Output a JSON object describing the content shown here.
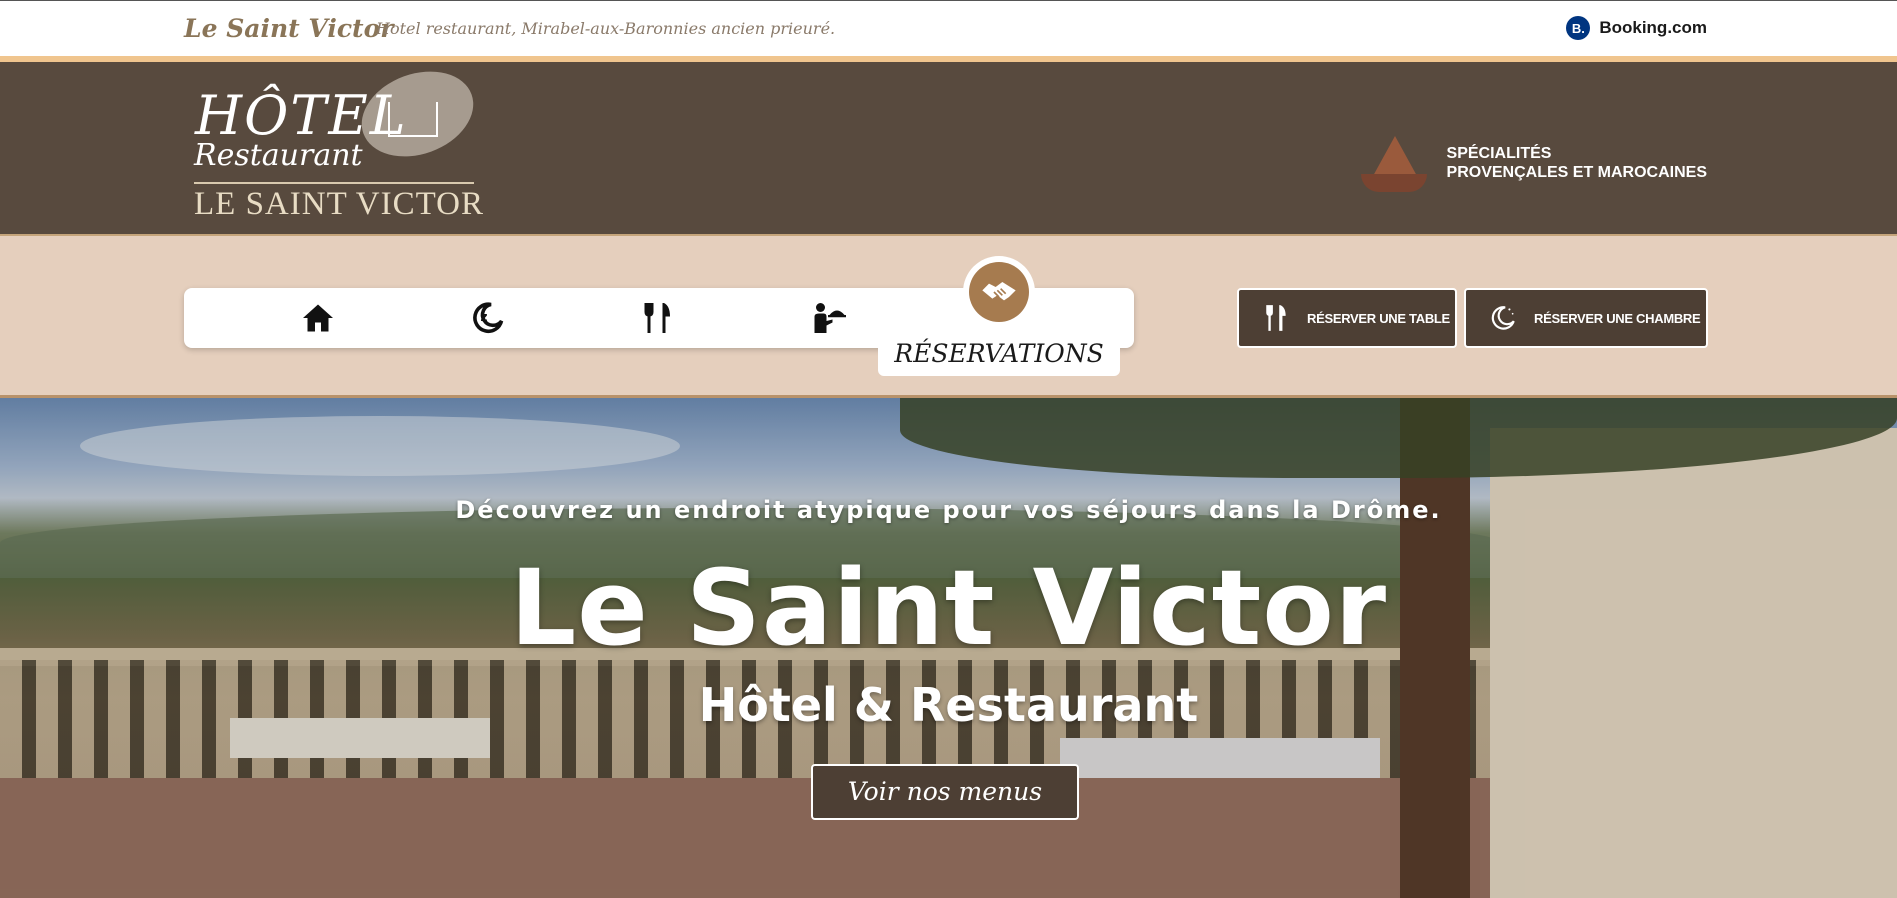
{
  "topbar": {
    "brand": "Le Saint Victor",
    "tagline": "Hotel restaurant, Mirabel-aux-Baronnies ancien prieuré.",
    "booking_icon": "B.",
    "booking_label": "Booking.com"
  },
  "header": {
    "logo": {
      "line1": "HÔTEL",
      "line2": "Restaurant",
      "line3": "LE SAINT VICTOR"
    },
    "specialites": {
      "line1": "SPÉCIALITÉS",
      "line2": "PROVENÇALES ET MAROCAINES",
      "icon": "tajine-icon"
    }
  },
  "nav": {
    "items": [
      {
        "icon": "home-icon"
      },
      {
        "icon": "moon-icon"
      },
      {
        "icon": "cutlery-icon"
      },
      {
        "icon": "waiter-icon"
      },
      {
        "icon": "handshake-icon",
        "label": "RÉSERVATIONS",
        "active": true
      }
    ]
  },
  "actions": {
    "table_label": "RÉSERVER UNE TABLE",
    "chambre_label": "RÉSERVER UNE CHAMBRE"
  },
  "hero": {
    "subtitle": "Découvrez un endroit atypique pour vos séjours dans la Drôme.",
    "title": "Le Saint Victor",
    "subtitle2": "Hôtel & Restaurant",
    "cta": "Voir nos menus"
  },
  "colors": {
    "brown_dark": "#584a3e",
    "beige": "#e5cfbd",
    "gold": "#a67b4f",
    "stripe": "#f0c58e"
  }
}
